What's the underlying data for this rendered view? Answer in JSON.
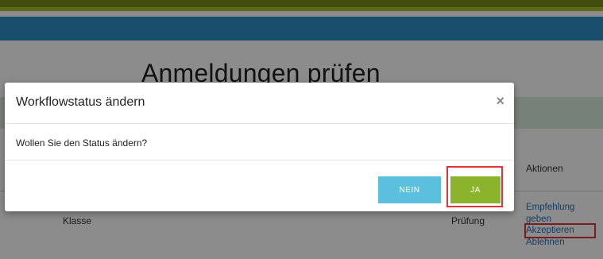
{
  "page": {
    "title": "Anmeldungen prüfen"
  },
  "table": {
    "header_actions": "Aktionen",
    "row": {
      "klasse": "Klasse",
      "pruefung": "Prüfung",
      "actions": [
        "Empfehlung geben",
        "Akzeptieren",
        "Ablehnen"
      ]
    }
  },
  "modal": {
    "title": "Workflowstatus ändern",
    "close_icon": "close-icon",
    "body_text": "Wollen Sie den Status ändern?",
    "no_label": "NEIN",
    "yes_label": "JA"
  },
  "colors": {
    "band_olive": "#7b8a1c",
    "band_green": "#a7c430",
    "band_blue": "#2f8fc7",
    "no_button": "#5bc0de",
    "yes_button": "#8bb42c",
    "highlight": "#e0333a",
    "link": "#2c6fb3"
  }
}
